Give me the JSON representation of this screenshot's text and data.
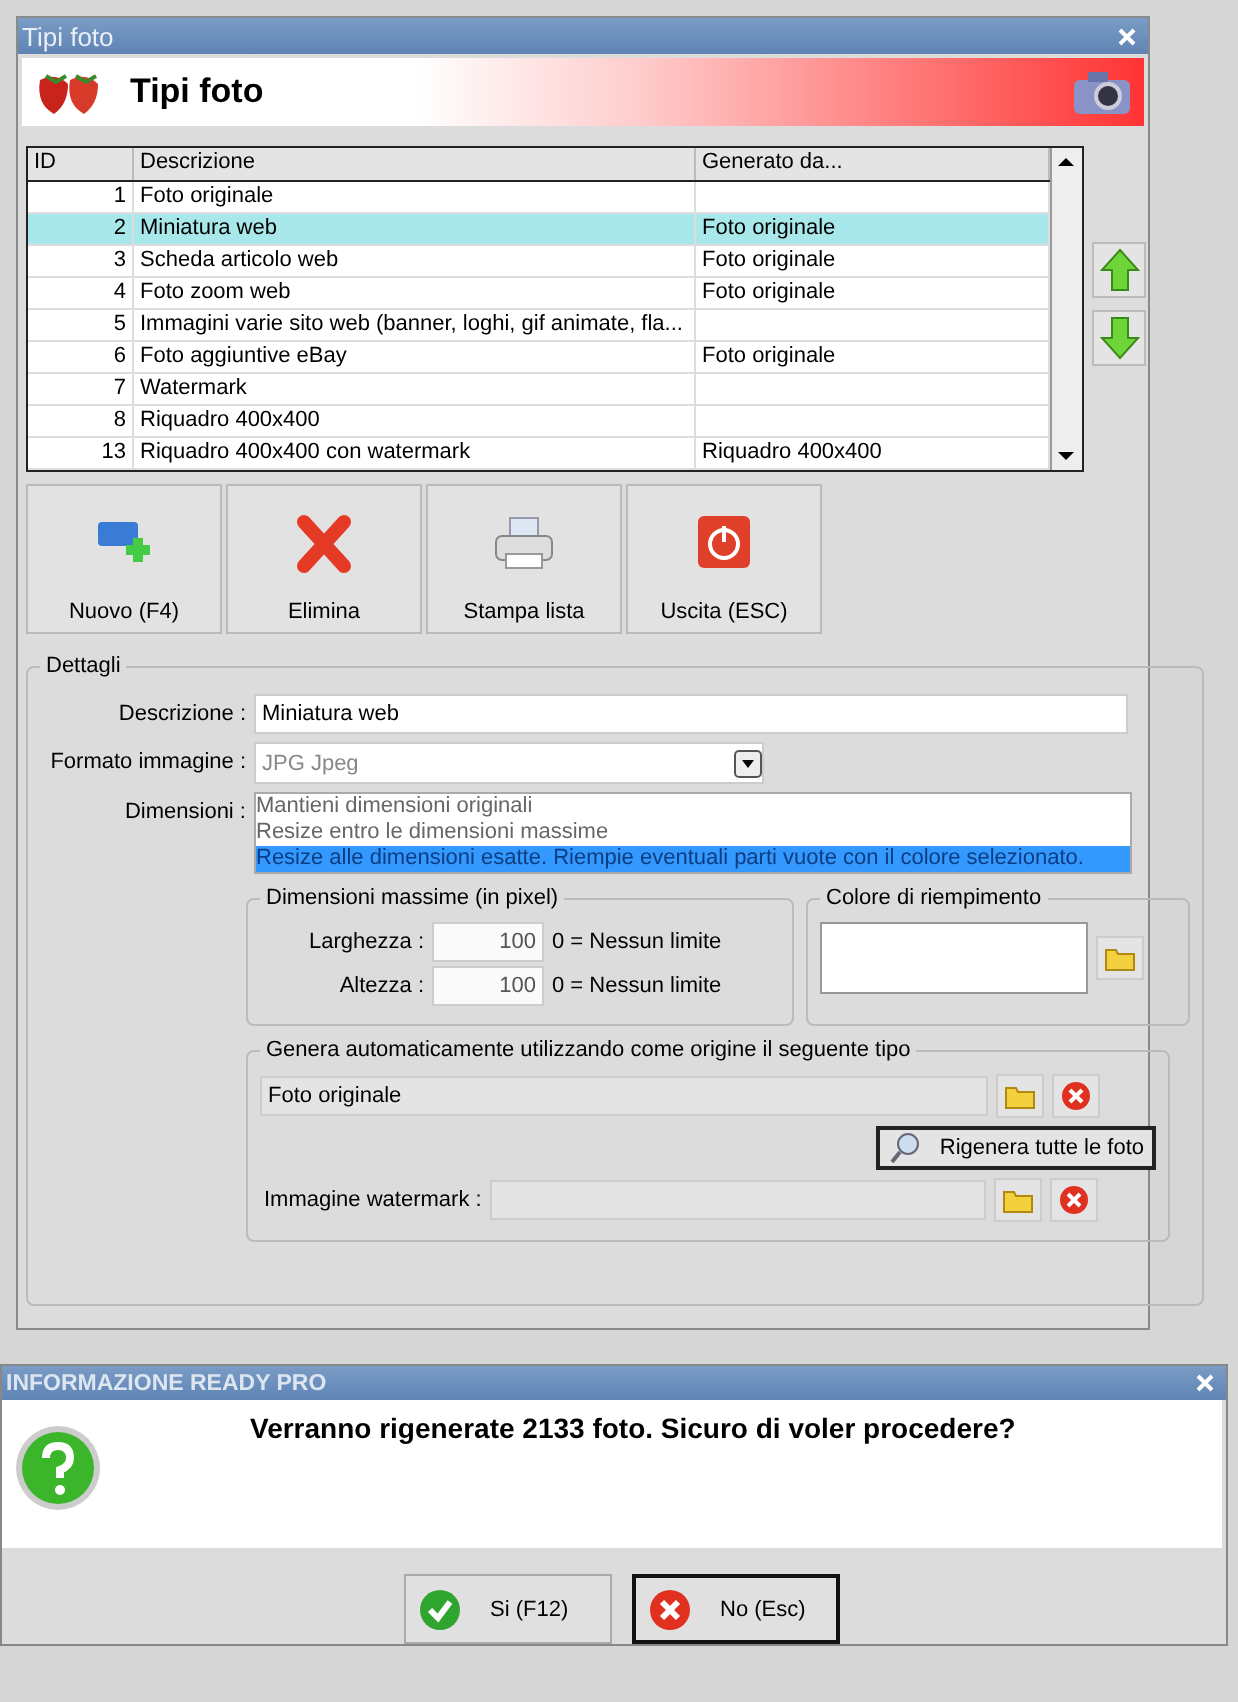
{
  "window": {
    "title": "Tipi foto",
    "header": "Tipi foto"
  },
  "table": {
    "columns": [
      "ID",
      "Descrizione",
      "Generato da..."
    ],
    "rows": [
      {
        "id": "1",
        "descrizione": "Foto originale",
        "generato": "",
        "selected": false
      },
      {
        "id": "2",
        "descrizione": "Miniatura web",
        "generato": "Foto originale",
        "selected": true
      },
      {
        "id": "3",
        "descrizione": "Scheda articolo web",
        "generato": "Foto originale",
        "selected": false
      },
      {
        "id": "4",
        "descrizione": "Foto zoom web",
        "generato": "Foto originale",
        "selected": false
      },
      {
        "id": "5",
        "descrizione": "Immagini varie sito web (banner, loghi, gif animate, fla...",
        "generato": "",
        "selected": false
      },
      {
        "id": "6",
        "descrizione": "Foto aggiuntive eBay",
        "generato": "Foto originale",
        "selected": false
      },
      {
        "id": "7",
        "descrizione": "Watermark",
        "generato": "",
        "selected": false
      },
      {
        "id": "8",
        "descrizione": "Riquadro 400x400",
        "generato": "",
        "selected": false
      },
      {
        "id": "13",
        "descrizione": "Riquadro 400x400 con watermark",
        "generato": "Riquadro 400x400",
        "selected": false
      }
    ]
  },
  "toolbar": [
    {
      "kind": "new",
      "label": "Nuovo (F4)"
    },
    {
      "kind": "delete",
      "label": "Elimina"
    },
    {
      "kind": "print",
      "label": "Stampa lista"
    },
    {
      "kind": "exit",
      "label": "Uscita (ESC)"
    }
  ],
  "details": {
    "title": "Dettagli",
    "descrizione": {
      "label": "Descrizione :",
      "value": "Miniatura web"
    },
    "formato": {
      "label": "Formato immagine :",
      "value": "JPG Jpeg"
    },
    "dimensioni": {
      "label": "Dimensioni :",
      "options": [
        {
          "label": "Mantieni dimensioni originali",
          "selected": false
        },
        {
          "label": "Resize entro le dimensioni massime",
          "selected": false
        },
        {
          "label": "Resize alle dimensioni esatte. Riempie eventuali parti vuote con il colore selezionato.",
          "selected": true
        }
      ]
    },
    "max": {
      "title": "Dimensioni massime (in pixel)",
      "fields": [
        {
          "label": "Larghezza :",
          "value": "100",
          "hint": "0 = Nessun limite"
        },
        {
          "label": "Altezza :",
          "value": "100",
          "hint": "0 = Nessun limite"
        }
      ]
    },
    "colore": {
      "title": "Colore di riempimento"
    },
    "genera": {
      "title": "Genera automaticamente utilizzando come origine il seguente tipo",
      "value": "Foto originale",
      "button": "Rigenera tutte le foto",
      "watermark_label": "Immagine watermark :"
    }
  },
  "dialog": {
    "title": "INFORMAZIONE READY PRO",
    "message": "Verranno rigenerate 2133 foto. Sicuro di voler procedere?",
    "buttons": [
      {
        "kind": "yes",
        "label": "Si (F12)",
        "selected": false
      },
      {
        "kind": "no",
        "label": "No (Esc)",
        "selected": true
      }
    ]
  }
}
